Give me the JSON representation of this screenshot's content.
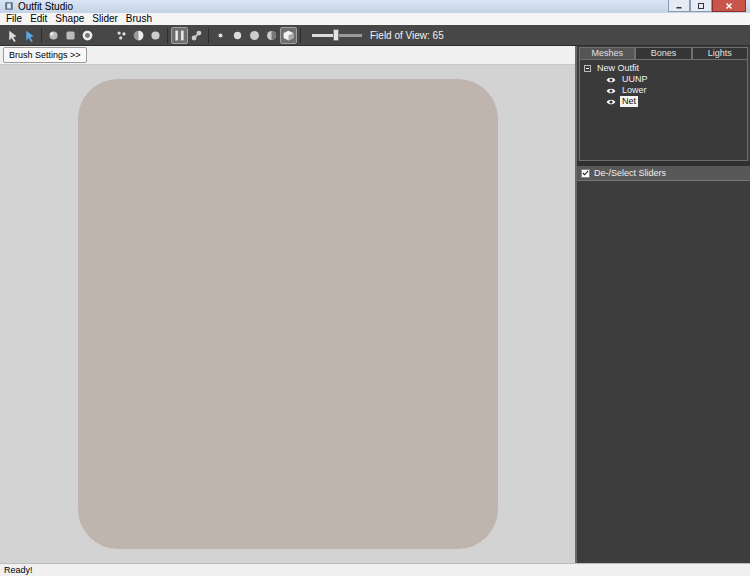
{
  "window": {
    "title": "Outfit Studio"
  },
  "menu": [
    "File",
    "Edit",
    "Shape",
    "Slider",
    "Brush"
  ],
  "toolbar": {
    "tools": [
      {
        "selected": false
      },
      {
        "selected": false
      },
      {
        "selected": false
      },
      {
        "selected": false
      },
      {
        "selected": false
      },
      {
        "selected": false
      },
      {
        "selected": false
      },
      {
        "selected": false
      },
      {
        "selected": false
      },
      {
        "selected": true
      },
      {
        "selected": false
      },
      {
        "selected": false
      },
      {
        "selected": false
      },
      {
        "selected": false
      },
      {
        "selected": false
      },
      {
        "selected": true
      }
    ],
    "fov": {
      "label": "Field of View: 65",
      "level": 0.48
    }
  },
  "brush_button": "Brush Settings >>",
  "panel_tabs": [
    {
      "label": "Meshes",
      "selected": true
    },
    {
      "label": "Bones",
      "selected": false
    },
    {
      "label": "Lights",
      "selected": false
    }
  ],
  "tree": {
    "label": "New Outfit",
    "expanded": true,
    "children": [
      {
        "label": "UUNP",
        "visible": true,
        "selected": false
      },
      {
        "label": "Lower",
        "visible": true,
        "selected": false
      },
      {
        "label": "Net",
        "visible": true,
        "selected": true
      }
    ]
  },
  "sliders_header": {
    "label": "De-/Select Sliders",
    "checked": true
  },
  "status_bar": "Ready!"
}
